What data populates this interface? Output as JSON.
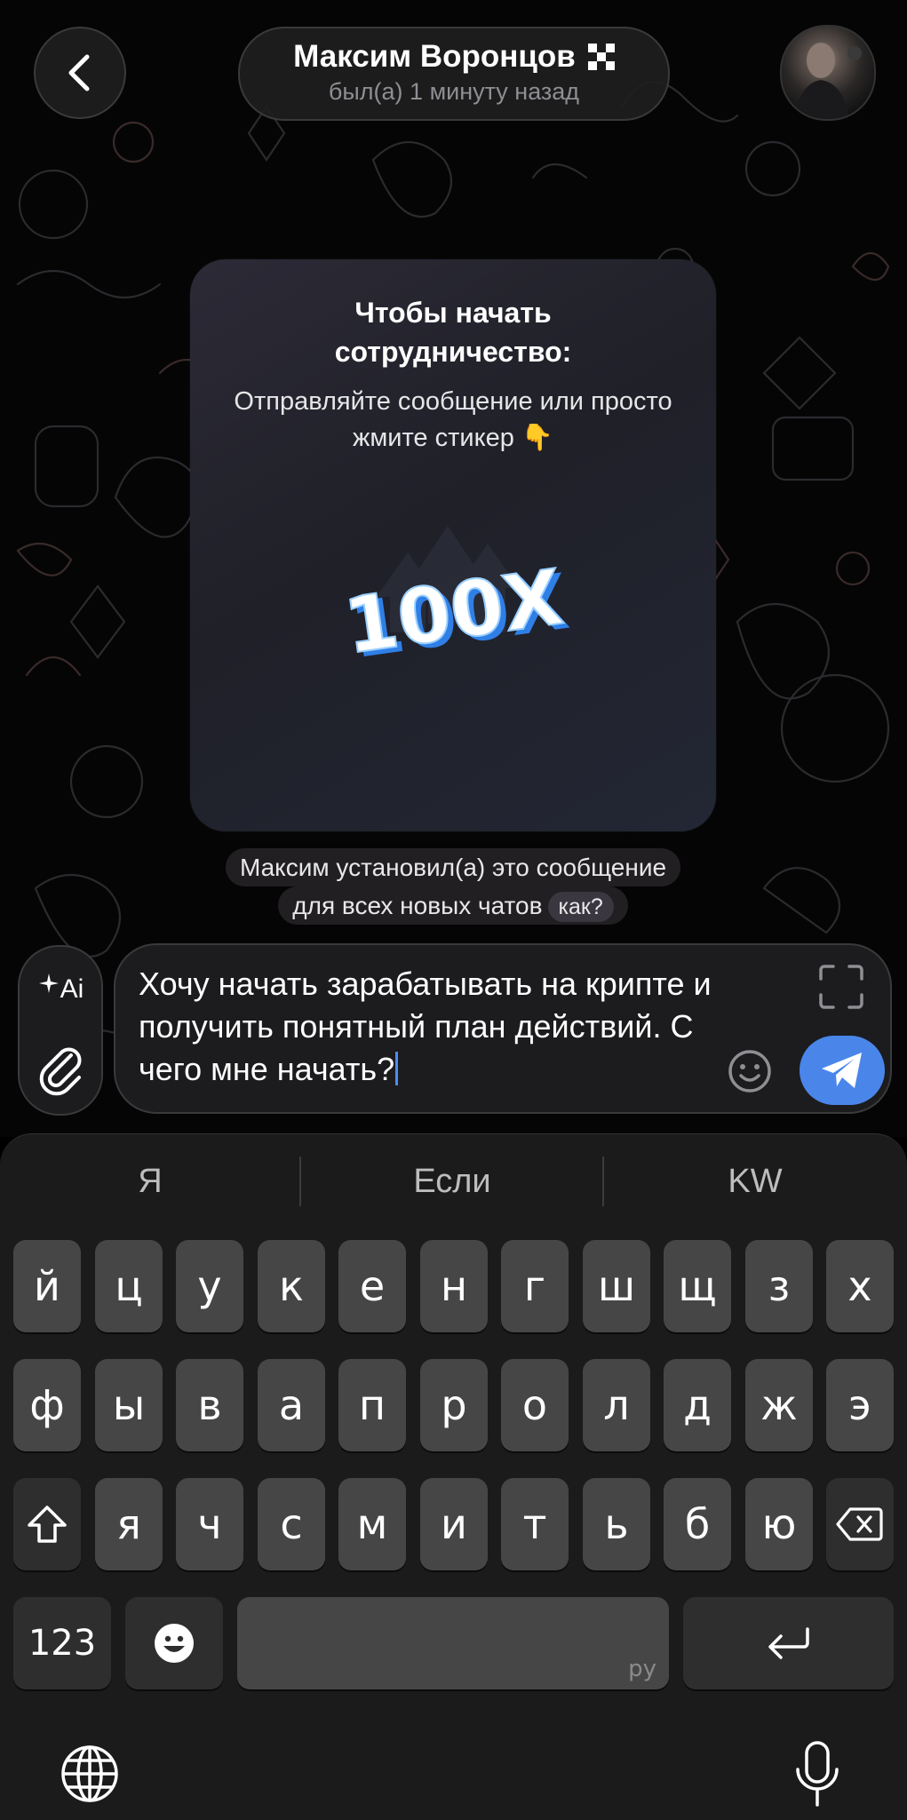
{
  "header": {
    "name": "Максим Воронцов",
    "status": "был(а) 1 минуту назад"
  },
  "card": {
    "title": "Чтобы начать сотрудничество:",
    "text": "Отправляйте сообщение или просто жмите стикер 👇",
    "sticker_text": "100X"
  },
  "service_message": {
    "line1": "Максим установил(а) это сообщение",
    "line2": "для всех новых чатов",
    "how_label": "как?"
  },
  "composer": {
    "text": "Хочу начать зарабатывать на крипте и получить понятный план действий. С чего мне начать?",
    "ai_label": "Ai"
  },
  "keyboard": {
    "suggestions": [
      "Я",
      "Если",
      "KW"
    ],
    "row1": [
      "й",
      "ц",
      "у",
      "к",
      "е",
      "н",
      "г",
      "ш",
      "щ",
      "з",
      "х"
    ],
    "row2": [
      "ф",
      "ы",
      "в",
      "а",
      "п",
      "р",
      "о",
      "л",
      "д",
      "ж",
      "э"
    ],
    "row3": [
      "я",
      "ч",
      "с",
      "м",
      "и",
      "т",
      "ь",
      "б",
      "ю"
    ],
    "numbers_label": "123",
    "space_lang": "ру"
  },
  "colors": {
    "accent": "#4a86ea",
    "key": "#464646",
    "keyboard_bg": "#1b1b1b"
  }
}
